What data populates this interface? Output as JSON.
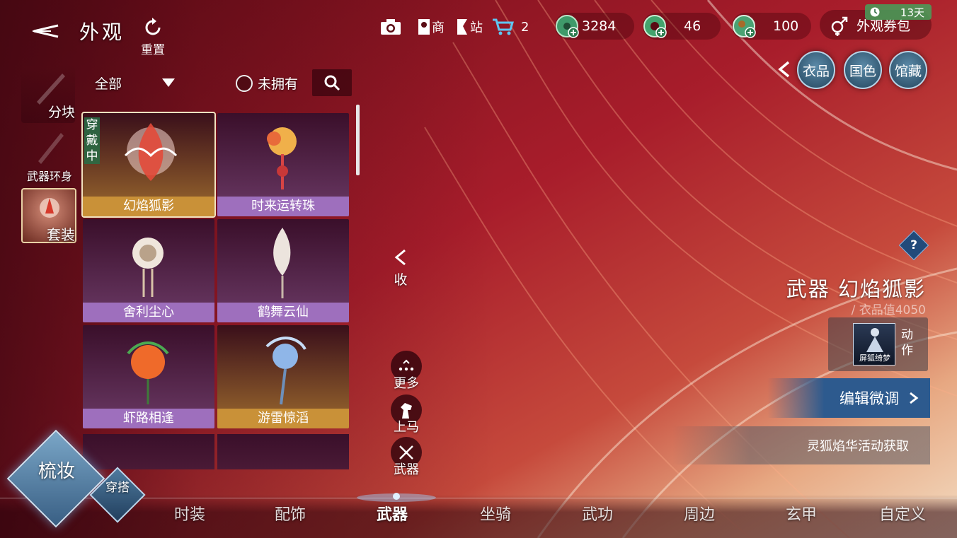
{
  "header": {
    "title": "外观",
    "reset_label": "重置"
  },
  "toolbar": {
    "shop_label": "商",
    "station_label": "站",
    "cart_count": "2"
  },
  "currencies": [
    {
      "value": "3284"
    },
    {
      "value": "46"
    },
    {
      "value": "100"
    }
  ],
  "coupon": {
    "label": "外观券包",
    "days": "13天"
  },
  "round_buttons": [
    "衣品",
    "国色",
    "馆藏"
  ],
  "categories": {
    "block": "分块",
    "weapon_ring": "武器环身",
    "suit": "套装"
  },
  "filter": {
    "selected": "全部",
    "not_owned": "未拥有"
  },
  "items": [
    {
      "name": "幻焰狐影",
      "style": "gold",
      "tag": "穿戴中"
    },
    {
      "name": "时来运转珠",
      "style": "purple"
    },
    {
      "name": "舍利尘心",
      "style": "purple"
    },
    {
      "name": "鹤舞云仙",
      "style": "purple"
    },
    {
      "name": "虾路相逢",
      "style": "purple"
    },
    {
      "name": "游雷惊滔",
      "style": "gold"
    }
  ],
  "collapse_label": "收",
  "side_actions": {
    "more": "更多",
    "mount": "上马",
    "weapon": "武器"
  },
  "detail": {
    "title": "武器 幻焰狐影",
    "score": "/ 衣品值4050",
    "action_label": "动作",
    "action_thumb": "屏狐绮梦",
    "edit_label": "编辑微调",
    "source": "灵狐焰华活动获取"
  },
  "tabs": [
    "时装",
    "配饰",
    "武器",
    "坐骑",
    "武功",
    "周边",
    "玄甲",
    "自定义"
  ],
  "active_tab": "武器",
  "corner": {
    "primary": "梳妆",
    "secondary": "穿搭"
  },
  "colors": {
    "accent_gold": "#c99138",
    "accent_purple": "#9e6fbd",
    "accent_blue": "#2d5a8e",
    "coupon_green": "#46a05a"
  }
}
